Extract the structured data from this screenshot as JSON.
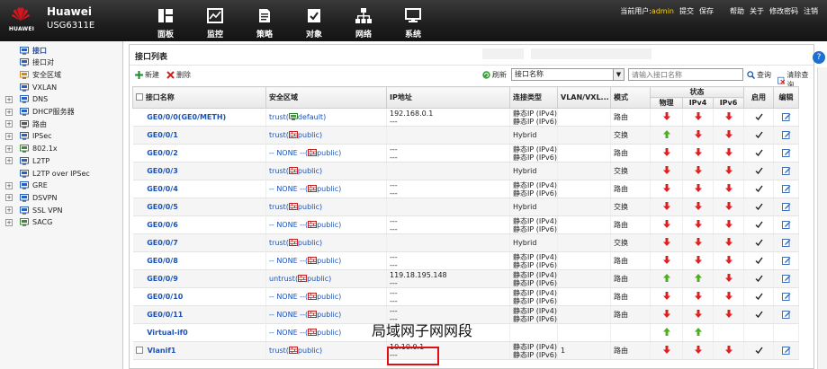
{
  "header": {
    "brand": "Huawei",
    "model": "USG6311E",
    "logo_text": "HUAWEI",
    "nav": [
      {
        "label": "面板",
        "icon": "dashboard-icon"
      },
      {
        "label": "监控",
        "icon": "monitor-icon"
      },
      {
        "label": "策略",
        "icon": "policy-icon"
      },
      {
        "label": "对象",
        "icon": "object-icon"
      },
      {
        "label": "网络",
        "icon": "network-icon"
      },
      {
        "label": "系统",
        "icon": "system-icon"
      }
    ],
    "user_prefix": "当前用户:",
    "username": "admin",
    "menu": [
      "提交",
      "保存",
      "帮助",
      "关于",
      "修改密码",
      "注销"
    ]
  },
  "sidebar": {
    "items": [
      {
        "label": "接口",
        "icon": "interface-icon",
        "expandable": false,
        "active": true
      },
      {
        "label": "接口对",
        "icon": "interface-pair-icon",
        "expandable": false
      },
      {
        "label": "安全区域",
        "icon": "security-zone-icon",
        "expandable": false
      },
      {
        "label": "VXLAN",
        "icon": "vxlan-icon",
        "expandable": false
      },
      {
        "label": "DNS",
        "icon": "dns-icon",
        "expandable": true
      },
      {
        "label": "DHCP服务器",
        "icon": "dhcp-icon",
        "expandable": true
      },
      {
        "label": "路由",
        "icon": "route-icon",
        "expandable": true
      },
      {
        "label": "IPSec",
        "icon": "ipsec-icon",
        "expandable": true
      },
      {
        "label": "802.1x",
        "icon": "dot1x-icon",
        "expandable": true
      },
      {
        "label": "L2TP",
        "icon": "l2tp-icon",
        "expandable": true
      },
      {
        "label": "L2TP over IPSec",
        "icon": "l2tp-ipsec-icon",
        "expandable": false
      },
      {
        "label": "GRE",
        "icon": "gre-icon",
        "expandable": true
      },
      {
        "label": "DSVPN",
        "icon": "dsvpn-icon",
        "expandable": true
      },
      {
        "label": "SSL VPN",
        "icon": "sslvpn-icon",
        "expandable": true
      },
      {
        "label": "SACG",
        "icon": "sacg-icon",
        "expandable": true
      }
    ]
  },
  "panel": {
    "title": "接口列表",
    "toolbar": {
      "new_label": "新建",
      "delete_label": "删除",
      "refresh_label": "刷新",
      "filter_value": "接口名称",
      "search_placeholder": "请输入接口名称",
      "query_label": "查询",
      "clear_label": "清除查询"
    },
    "columns": {
      "name": "接口名称",
      "zone": "安全区域",
      "ip": "IP地址",
      "conn": "连接类型",
      "vlan": "VLAN/VXL...",
      "mode": "模式",
      "status": "状态",
      "phys": "物理",
      "ipv4": "IPv4",
      "ipv6": "IPv6",
      "enable": "启用",
      "edit": "编辑"
    },
    "rows": [
      {
        "name": "GE0/0/0(GE0/METH)",
        "zone_prefix": "trust(",
        "zone_name": "default)",
        "zone_icon": "default-zone-icon",
        "ip1": "192.168.0.1",
        "ip2": "---",
        "conn1": "静态IP (IPv4)",
        "conn2": "静态IP (IPv6)",
        "vlan": "",
        "mode": "路由",
        "phys": "down",
        "ipv4": "down",
        "ipv6": "down",
        "enabled": true
      },
      {
        "name": "GE0/0/1",
        "zone_prefix": "trust(",
        "zone_name": "public)",
        "zone_icon": "public-zone-icon",
        "ip1": "",
        "ip2": "",
        "conn1": "Hybrid",
        "conn2": "",
        "vlan": "",
        "mode": "交换",
        "phys": "up",
        "ipv4": "down",
        "ipv6": "down",
        "enabled": true
      },
      {
        "name": "GE0/0/2",
        "zone_prefix": "-- NONE --(",
        "zone_name": "public)",
        "zone_icon": "public-zone-icon",
        "ip1": "---",
        "ip2": "---",
        "conn1": "静态IP (IPv4)",
        "conn2": "静态IP (IPv6)",
        "vlan": "",
        "mode": "路由",
        "phys": "down",
        "ipv4": "down",
        "ipv6": "down",
        "enabled": true
      },
      {
        "name": "GE0/0/3",
        "zone_prefix": "trust(",
        "zone_name": "public)",
        "zone_icon": "public-zone-icon",
        "ip1": "",
        "ip2": "",
        "conn1": "Hybrid",
        "conn2": "",
        "vlan": "",
        "mode": "交换",
        "phys": "down",
        "ipv4": "down",
        "ipv6": "down",
        "enabled": true
      },
      {
        "name": "GE0/0/4",
        "zone_prefix": "-- NONE --(",
        "zone_name": "public)",
        "zone_icon": "public-zone-icon",
        "ip1": "---",
        "ip2": "---",
        "conn1": "静态IP (IPv4)",
        "conn2": "静态IP (IPv6)",
        "vlan": "",
        "mode": "路由",
        "phys": "down",
        "ipv4": "down",
        "ipv6": "down",
        "enabled": true
      },
      {
        "name": "GE0/0/5",
        "zone_prefix": "trust(",
        "zone_name": "public)",
        "zone_icon": "public-zone-icon",
        "ip1": "",
        "ip2": "",
        "conn1": "Hybrid",
        "conn2": "",
        "vlan": "",
        "mode": "交换",
        "phys": "down",
        "ipv4": "down",
        "ipv6": "down",
        "enabled": true
      },
      {
        "name": "GE0/0/6",
        "zone_prefix": "-- NONE --(",
        "zone_name": "public)",
        "zone_icon": "public-zone-icon",
        "ip1": "---",
        "ip2": "---",
        "conn1": "静态IP (IPv4)",
        "conn2": "静态IP (IPv6)",
        "vlan": "",
        "mode": "路由",
        "phys": "down",
        "ipv4": "down",
        "ipv6": "down",
        "enabled": true
      },
      {
        "name": "GE0/0/7",
        "zone_prefix": "trust(",
        "zone_name": "public)",
        "zone_icon": "public-zone-icon",
        "ip1": "",
        "ip2": "",
        "conn1": "Hybrid",
        "conn2": "",
        "vlan": "",
        "mode": "交换",
        "phys": "down",
        "ipv4": "down",
        "ipv6": "down",
        "enabled": true
      },
      {
        "name": "GE0/0/8",
        "zone_prefix": "-- NONE --(",
        "zone_name": "public)",
        "zone_icon": "public-zone-icon",
        "ip1": "---",
        "ip2": "---",
        "conn1": "静态IP (IPv4)",
        "conn2": "静态IP (IPv6)",
        "vlan": "",
        "mode": "路由",
        "phys": "down",
        "ipv4": "down",
        "ipv6": "down",
        "enabled": true
      },
      {
        "name": "GE0/0/9",
        "zone_prefix": "untrust(",
        "zone_name": "public)",
        "zone_icon": "public-zone-icon",
        "ip1": "119.18.195.148",
        "ip2": "---",
        "conn1": "静态IP (IPv4)",
        "conn2": "静态IP (IPv6)",
        "vlan": "",
        "mode": "路由",
        "phys": "up",
        "ipv4": "up",
        "ipv6": "down",
        "enabled": true
      },
      {
        "name": "GE0/0/10",
        "zone_prefix": "-- NONE --(",
        "zone_name": "public)",
        "zone_icon": "public-zone-icon",
        "ip1": "---",
        "ip2": "---",
        "conn1": "静态IP (IPv4)",
        "conn2": "静态IP (IPv6)",
        "vlan": "",
        "mode": "路由",
        "phys": "down",
        "ipv4": "down",
        "ipv6": "down",
        "enabled": true
      },
      {
        "name": "GE0/0/11",
        "zone_prefix": "-- NONE --(",
        "zone_name": "public)",
        "zone_icon": "public-zone-icon",
        "ip1": "---",
        "ip2": "---",
        "conn1": "静态IP (IPv4)",
        "conn2": "静态IP (IPv6)",
        "vlan": "",
        "mode": "路由",
        "phys": "down",
        "ipv4": "down",
        "ipv6": "down",
        "enabled": true
      },
      {
        "name": "Virtual-if0",
        "zone_prefix": "-- NONE --(",
        "zone_name": "public)",
        "zone_icon": "public-zone-icon",
        "ip1": "",
        "ip2": "",
        "conn1": "",
        "conn2": "",
        "vlan": "",
        "mode": "",
        "phys": "up",
        "ipv4": "up",
        "ipv6": "",
        "enabled": false
      },
      {
        "name": "Vlanif1",
        "zone_prefix": "trust(",
        "zone_name": "public)",
        "zone_icon": "public-zone-icon",
        "ip1": "10.10.0.1",
        "ip2": "---",
        "conn1": "静态IP (IPv4)",
        "conn2": "静态IP (IPv6)",
        "vlan": "1",
        "mode": "路由",
        "phys": "down",
        "ipv4": "down",
        "ipv6": "down",
        "enabled": true,
        "checkbox": true
      }
    ]
  },
  "annotation": {
    "text": "局域网子网网段",
    "color": "#e01010"
  },
  "colors": {
    "accent": "#1a52b8",
    "up": "#4caf1e",
    "down": "#e02020",
    "header_bg": "#1e1e1e"
  }
}
